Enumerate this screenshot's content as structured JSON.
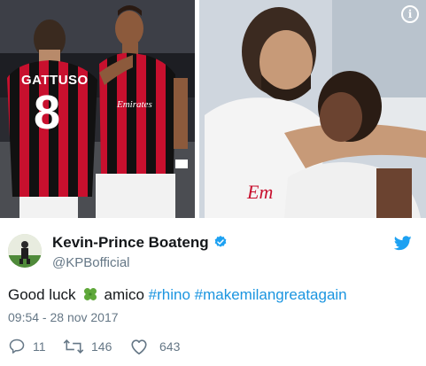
{
  "author": {
    "name": "Kevin-Prince Boateng",
    "handle": "@KPBofficial",
    "verified": true
  },
  "tweet": {
    "text_before": "Good luck",
    "emoji": "four-leaf-clover",
    "text_after": "amico",
    "hashtags": [
      "#rhino",
      "#makemilangreatagain"
    ],
    "timestamp": "09:54 - 28 nov 2017"
  },
  "photo_left": {
    "jersey_name": "GATTUSO",
    "jersey_number": "8",
    "sponsor": "Emirates"
  },
  "photo_right": {
    "shirt_text": "Em"
  },
  "actions": {
    "replies": "11",
    "retweets": "146",
    "likes": "643"
  },
  "colors": {
    "link": "#1b95e0",
    "muted": "#657786",
    "milan_red": "#c8102e"
  },
  "icons": [
    "info-icon",
    "verified-badge-icon",
    "twitter-bird-icon",
    "four-leaf-clover-icon",
    "reply-icon",
    "retweet-icon",
    "like-icon"
  ]
}
